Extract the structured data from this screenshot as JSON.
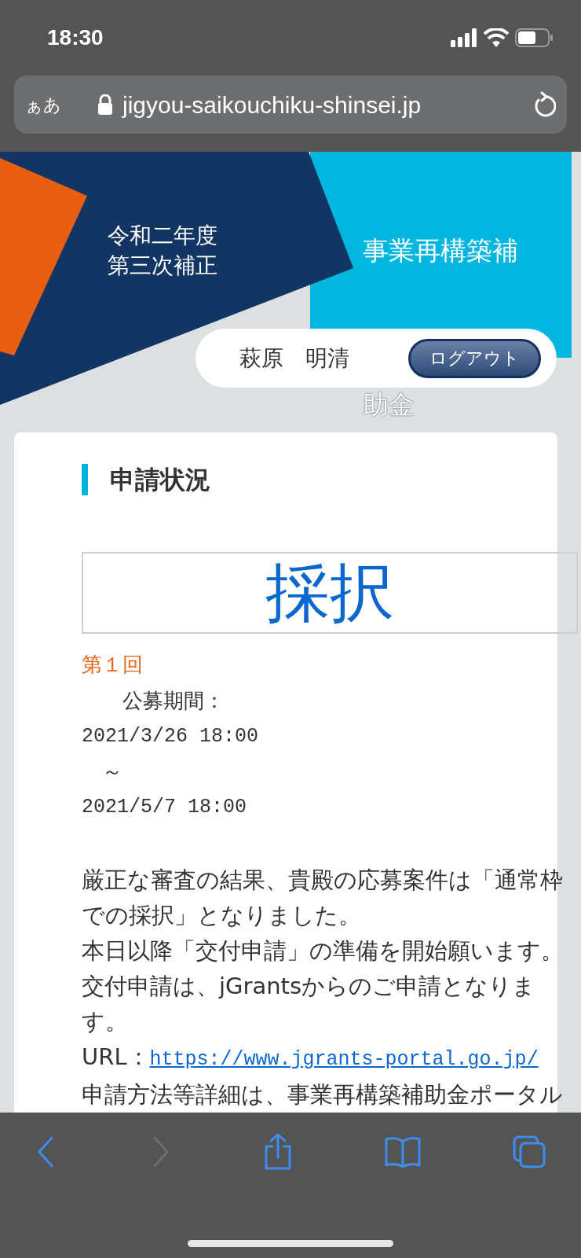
{
  "status_bar": {
    "time": "18:30"
  },
  "address_bar": {
    "text_size_button": "ぁあ",
    "url": "jigyou-saikouchiku-shinsei.jp"
  },
  "header": {
    "fiscal_year": [
      "令和二年度",
      "第三次補正"
    ],
    "program_title": [
      "事業再構築補",
      "助金"
    ],
    "user_name": "萩原　明清",
    "logout_button": "ログアウト"
  },
  "card": {
    "heading": "申請状況",
    "result": "採択",
    "round": "第１回",
    "period_label": "　　公募期間：",
    "period_start": "2021/3/26 18:00",
    "period_separator": "　～",
    "period_end": "2021/5/7 18:00",
    "paragraphs": [
      "厳正な審査の結果、貴殿の応募案件は「通常枠での採択」となりました。",
      "本日以降「交付申請」の準備を開始願います。",
      "交付申請は、jGrantsからのご申請となります。"
    ],
    "url_label": "URL：",
    "url_link": "https://www.jgrants-portal.go.jp/",
    "last_line": "申請方法等詳細は、事業再構築補助金ポータル"
  },
  "toolbar": [
    {
      "kind": "back",
      "disabled": false
    },
    {
      "kind": "forward",
      "disabled": true
    },
    {
      "kind": "share",
      "disabled": false
    },
    {
      "kind": "bookmarks",
      "disabled": false
    },
    {
      "kind": "tabs",
      "disabled": false
    }
  ]
}
